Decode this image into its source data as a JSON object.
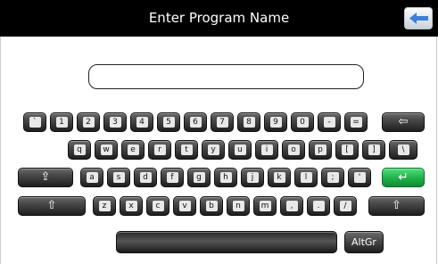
{
  "header": {
    "title": "Enter Program Name",
    "back_icon": "back-arrow-icon"
  },
  "input": {
    "value": ""
  },
  "keyboard": {
    "row1": [
      "`",
      "1",
      "2",
      "3",
      "4",
      "5",
      "6",
      "7",
      "8",
      "9",
      "0",
      "-",
      "="
    ],
    "row2": [
      "q",
      "w",
      "e",
      "r",
      "t",
      "y",
      "u",
      "i",
      "o",
      "p",
      "[",
      "]",
      "\\"
    ],
    "row3": [
      "a",
      "s",
      "d",
      "f",
      "g",
      "h",
      "j",
      "k",
      "l",
      ";",
      "'"
    ],
    "row4": [
      "z",
      "x",
      "c",
      "v",
      "b",
      "n",
      "m",
      ",",
      ".",
      "/"
    ],
    "backspace_symbol": "⇦",
    "caps_symbol": "⇪",
    "enter_symbol": "↵",
    "shift_symbol": "⇧",
    "altgr_label": "AltGr"
  }
}
